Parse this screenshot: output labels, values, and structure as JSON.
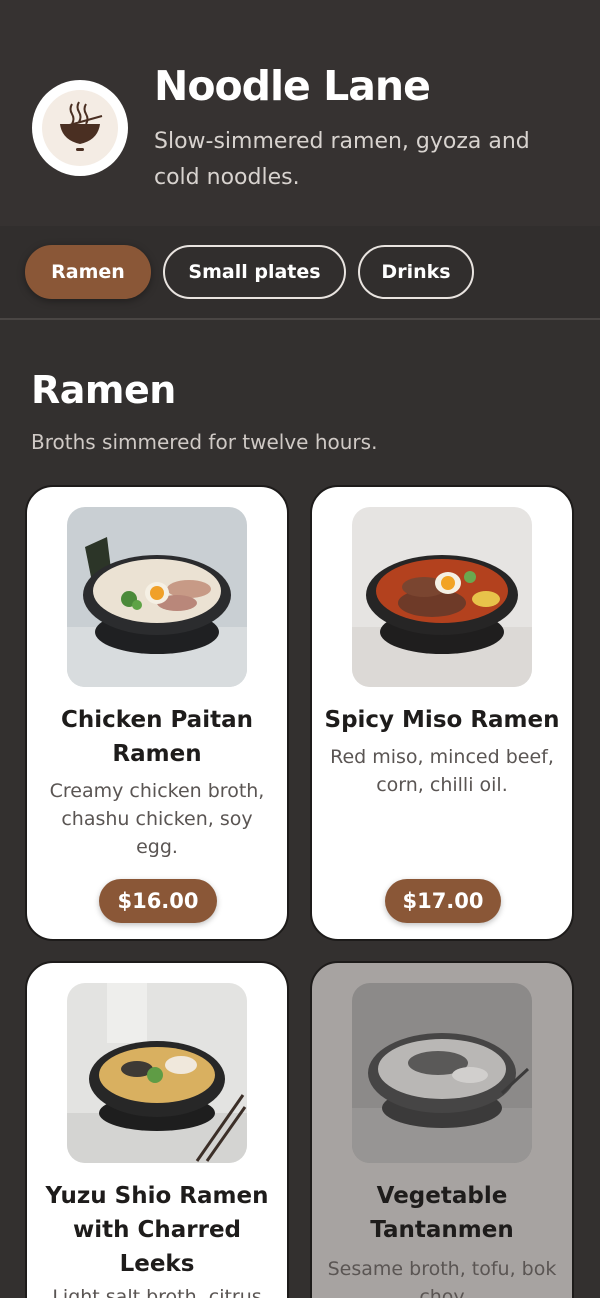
{
  "header": {
    "title": "Noodle Lane",
    "subtitle": "Slow-simmered ramen, gyoza and cold noodles."
  },
  "tabs": [
    {
      "label": "Ramen",
      "active": true
    },
    {
      "label": "Small plates",
      "active": false
    },
    {
      "label": "Drinks",
      "active": false
    }
  ],
  "section": {
    "title": "Ramen",
    "subtitle": "Broths simmered for twelve hours."
  },
  "items": [
    {
      "name": "Chicken Paitan Ramen",
      "description": "Creamy chicken broth, chashu chicken, soy egg.",
      "price": "$16.00",
      "icon": "ramen-photo"
    },
    {
      "name": "Spicy Miso Ramen",
      "description": "Red miso, minced beef, corn, chilli oil.",
      "price": "$17.00",
      "icon": "ramen-photo"
    },
    {
      "name": "Yuzu Shio Ramen with Charred Leeks",
      "description": "Light salt broth, citrus",
      "price": "",
      "icon": "ramen-photo"
    },
    {
      "name": "Vegetable Tantanmen",
      "description": "Sesame broth, tofu, bok choy",
      "price": "",
      "icon": "ramen-photo",
      "unavailable": true
    }
  ],
  "colors": {
    "background": "#33302f",
    "accent": "#8a5737",
    "card": "#ffffff",
    "card_unavailable": "#a7a3a1"
  }
}
